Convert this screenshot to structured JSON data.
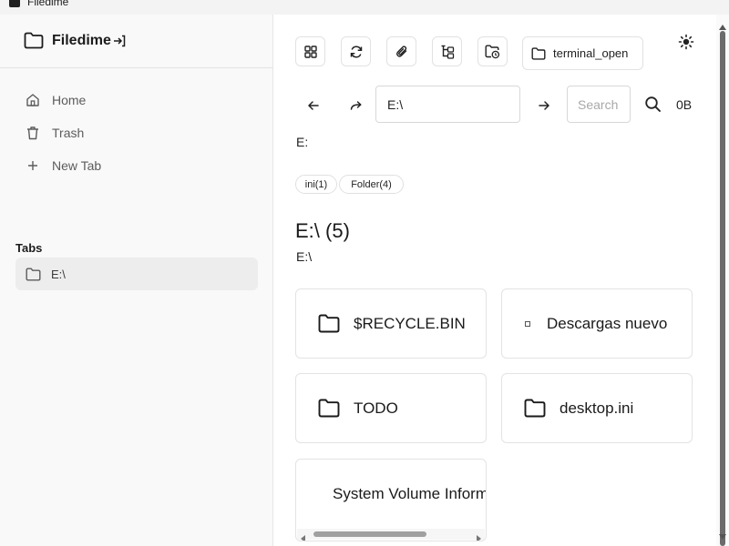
{
  "window": {
    "title": "Filedime"
  },
  "sidebar": {
    "brand": "Filedime",
    "nav": [
      {
        "label": "Home",
        "icon": "home-icon"
      },
      {
        "label": "Trash",
        "icon": "trash-icon"
      },
      {
        "label": "New Tab",
        "icon": "plus-icon"
      }
    ],
    "tabs_heading": "Tabs",
    "tabs": [
      {
        "label": "E:\\",
        "icon": "folder-icon"
      }
    ]
  },
  "toolbar": {
    "terminal_label": "terminal_open",
    "icons": [
      "grid-icon",
      "refresh-icon",
      "paperclip-icon",
      "tree-icon",
      "folder-clock-icon",
      "sun-icon"
    ]
  },
  "navbar": {
    "path_value": "E:\\",
    "search_placeholder": "Search",
    "size_label": "0B"
  },
  "breadcrumb": "E:",
  "filters": [
    {
      "label": "ini(1)"
    },
    {
      "label": "Folder(4)"
    }
  ],
  "directory": {
    "title": "E:\\ (5)",
    "subtitle": "E:\\"
  },
  "items": [
    {
      "name": "$RECYCLE.BIN",
      "icon": "folder-icon"
    },
    {
      "name": "Descargas nuevo",
      "icon": "small-square-icon"
    },
    {
      "name": "TODO",
      "icon": "folder-icon"
    },
    {
      "name": "desktop.ini",
      "icon": "folder-icon"
    },
    {
      "name": "System Volume Information",
      "icon": ""
    }
  ]
}
